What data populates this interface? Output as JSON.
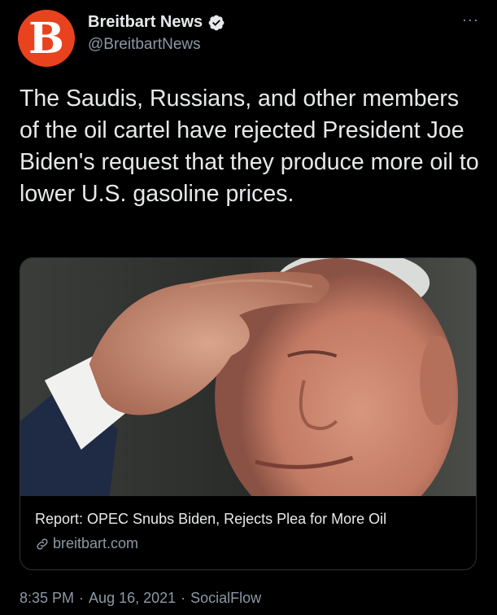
{
  "author": {
    "avatar_letter": "B",
    "avatar_color": "#e8421f",
    "display_name": "Breitbart News",
    "handle": "@BreitbartNews",
    "verified_icon": "verified-badge-icon"
  },
  "more_label": "···",
  "tweet": {
    "text": "The Saudis, Russians, and other members of the oil cartel have rejected President Joe Biden's request that they produce more oil to lower U.S. gasoline prices."
  },
  "card": {
    "image_icon": "article-photo",
    "title": "Report: OPEC Snubs Biden, Rejects Plea for More Oil",
    "domain": "breitbart.com",
    "domain_icon": "link-icon"
  },
  "meta": {
    "time": "8:35 PM",
    "date": "Aug 16, 2021",
    "source": "SocialFlow",
    "separator": "·"
  },
  "colors": {
    "background": "#000000",
    "text_primary": "#e7e9ea",
    "text_secondary": "#8b98a5",
    "border": "#2f3336"
  }
}
